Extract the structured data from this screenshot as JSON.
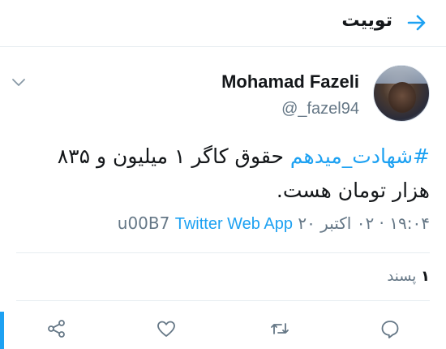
{
  "header": {
    "title": "توییت",
    "back_icon": "arrow-right-icon"
  },
  "tweet": {
    "author_name": "Mohamad Fazeli",
    "author_handle": "@_fazel94",
    "hashtag": "#شهادت_میدهم",
    "text_rest": " حقوق کاگر ۱ میلیون و ۸۳۵ هزار تومان هست.",
    "time": "۱۹:۰۴ · ۰۲ اکتبر ۲۰",
    "separator": "u00B7",
    "source_app": "Twitter Web App",
    "more_icon": "chevron-down-icon"
  },
  "stats": {
    "likes_count": "۱",
    "likes_label": "پسند"
  },
  "actions": [
    {
      "icon": "reply-icon"
    },
    {
      "icon": "retweet-icon"
    },
    {
      "icon": "like-icon"
    },
    {
      "icon": "share-icon"
    }
  ],
  "colors": {
    "accent": "#1da1f2",
    "secondary_text": "#657786",
    "divider": "#e6ecf0"
  }
}
